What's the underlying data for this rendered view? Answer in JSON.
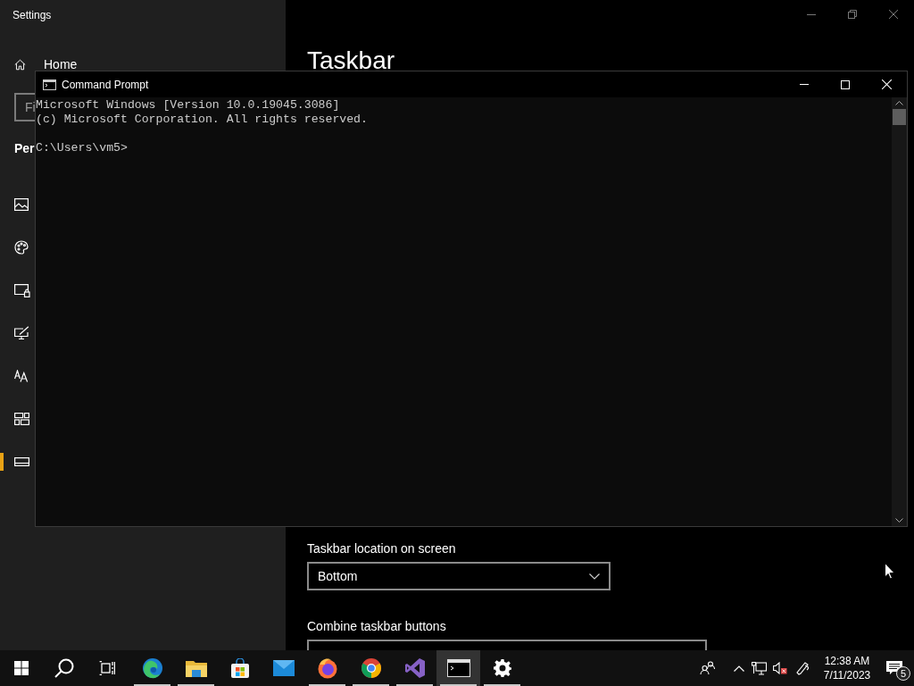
{
  "settings_window": {
    "title": "Settings",
    "sidebar": {
      "home": "Home",
      "search_placeholder": "Fi",
      "section": "Per",
      "items": [
        {
          "selected": false
        },
        {
          "selected": false
        },
        {
          "selected": false
        },
        {
          "selected": false
        },
        {
          "selected": false
        },
        {
          "selected": false
        },
        {
          "selected": true
        }
      ]
    },
    "page_title": "Taskbar",
    "location": {
      "label": "Taskbar location on screen",
      "value": "Bottom"
    },
    "combine": {
      "label": "Combine taskbar buttons"
    }
  },
  "cmd_window": {
    "title": "Command Prompt",
    "output": [
      "Microsoft Windows [Version 10.0.19045.3086]",
      "(c) Microsoft Corporation. All rights reserved."
    ],
    "prompt": "C:\\Users\\vm5>"
  },
  "taskbar": {
    "apps": [
      {
        "running": true,
        "selected": false
      },
      {
        "running": true,
        "selected": false
      },
      {
        "running": false,
        "selected": false
      },
      {
        "running": false,
        "selected": false
      },
      {
        "running": true,
        "selected": false
      },
      {
        "running": true,
        "selected": false
      },
      {
        "running": true,
        "selected": false
      },
      {
        "running": true,
        "selected": true
      },
      {
        "running": true,
        "selected": false
      }
    ],
    "time": "12:38 AM",
    "date": "7/11/2023",
    "notifications": "5"
  }
}
